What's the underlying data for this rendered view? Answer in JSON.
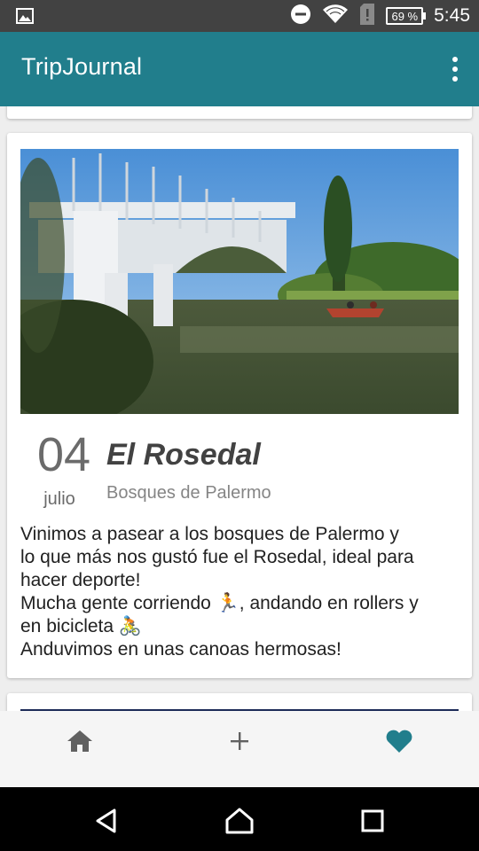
{
  "status_bar": {
    "battery": "69 %",
    "time": "5:45",
    "icons": [
      "image-icon",
      "dnd-icon",
      "wifi-icon",
      "sim-alert-icon",
      "battery-icon"
    ]
  },
  "app_bar": {
    "title": "TripJournal",
    "menu_icon": "more-vert-icon"
  },
  "entry": {
    "day": "04",
    "month": "julio",
    "title": "El Rosedal",
    "subtitle": "Bosques de Palermo",
    "body": "Vinimos a pasear a los bosques de Palermo y\nlo que más nos gustó fue el Rosedal,  ideal para\nhacer deporte!\nMucha gente corriendo 🏃,  andando en rollers y\nen bicicleta 🚴\nAnduvimos en unas canoas hermosas!",
    "photo": "park-bridge-lake-photo"
  },
  "bottom_nav": {
    "items": [
      {
        "icon": "home-icon",
        "active": false
      },
      {
        "icon": "add-icon",
        "active": false
      },
      {
        "icon": "heart-icon",
        "active": true
      }
    ],
    "active_color": "#217e8c",
    "inactive_color": "#616161"
  },
  "system_nav": {
    "items": [
      "back-icon",
      "home-circle-icon",
      "recents-icon"
    ]
  },
  "colors": {
    "primary": "#217e8c",
    "status_bar": "#424242"
  }
}
